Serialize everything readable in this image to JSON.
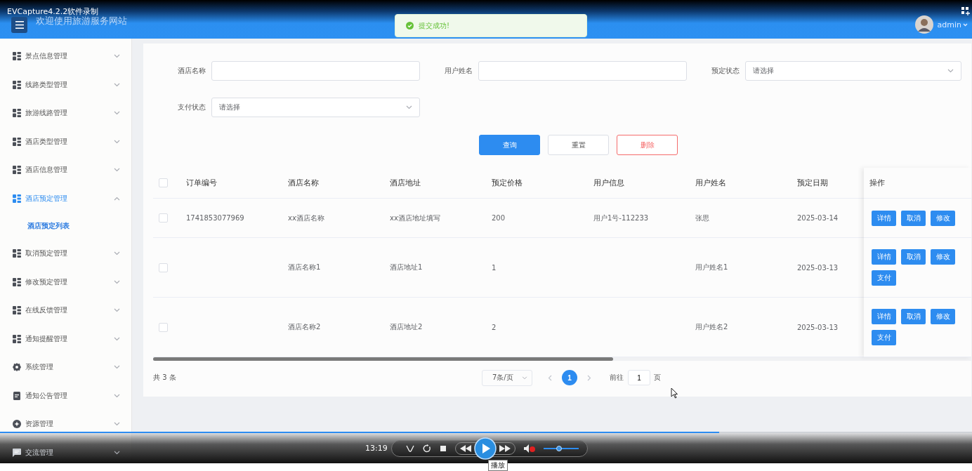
{
  "recorder_label": "EVCapture4.2.2软件录制",
  "header": {
    "title": "欢迎使用旅游服务网站",
    "user": "admin"
  },
  "toast": {
    "message": "提交成功!"
  },
  "sidebar": {
    "items": [
      {
        "label": "景点信息管理",
        "kind": "grid",
        "selected": false,
        "expanded": false
      },
      {
        "label": "线路类型管理",
        "kind": "grid",
        "selected": false,
        "expanded": false
      },
      {
        "label": "旅游线路管理",
        "kind": "grid",
        "selected": false,
        "expanded": false
      },
      {
        "label": "酒店类型管理",
        "kind": "grid",
        "selected": false,
        "expanded": false
      },
      {
        "label": "酒店信息管理",
        "kind": "grid",
        "selected": false,
        "expanded": false
      },
      {
        "label": "酒店预定管理",
        "kind": "grid",
        "selected": true,
        "expanded": true,
        "children": [
          {
            "label": "酒店预定列表",
            "selected": true
          }
        ]
      },
      {
        "label": "取消预定管理",
        "kind": "grid",
        "selected": false,
        "expanded": false
      },
      {
        "label": "修改预定管理",
        "kind": "grid",
        "selected": false,
        "expanded": false
      },
      {
        "label": "在线反馈管理",
        "kind": "grid",
        "selected": false,
        "expanded": false
      },
      {
        "label": "通知提醒管理",
        "kind": "grid",
        "selected": false,
        "expanded": false
      },
      {
        "label": "系统管理",
        "kind": "gear",
        "selected": false,
        "expanded": false
      },
      {
        "label": "通知公告管理",
        "kind": "doc",
        "selected": false,
        "expanded": false
      },
      {
        "label": "资源管理",
        "kind": "plus",
        "selected": false,
        "expanded": false
      },
      {
        "label": "交流管理",
        "kind": "chat",
        "selected": false,
        "expanded": false
      }
    ]
  },
  "filters": [
    {
      "label": "酒店名称",
      "kind": "text"
    },
    {
      "label": "用户姓名",
      "kind": "text"
    },
    {
      "label": "预定状态",
      "kind": "select",
      "placeholder": "请选择"
    },
    {
      "label": "支付状态",
      "kind": "select",
      "placeholder": "请选择"
    }
  ],
  "buttons": [
    {
      "label": "查询",
      "kind": "primary"
    },
    {
      "label": "重置",
      "kind": "default"
    },
    {
      "label": "删除",
      "kind": "danger"
    }
  ],
  "table": {
    "header_checked": false,
    "columns": [
      "订单编号",
      "酒店名称",
      "酒店地址",
      "预定价格",
      "用户信息",
      "用户姓名",
      "预定日期"
    ],
    "actions_label": "操作",
    "rows": [
      {
        "checked": false,
        "cells": [
          "1741853077969",
          "xx酒店名称",
          "xx酒店地址填写",
          "200",
          "用户1号-112233",
          "张思",
          "2025-03-14"
        ],
        "actions": [
          "详情",
          "取消",
          "修改"
        ]
      },
      {
        "checked": false,
        "cells": [
          null,
          "酒店名称1",
          "酒店地址1",
          "1",
          null,
          "用户姓名1",
          "2025-03-13"
        ],
        "actions": [
          "详情",
          "取消",
          "修改",
          "支付"
        ]
      },
      {
        "checked": false,
        "cells": [
          null,
          "酒店名称2",
          "酒店地址2",
          "2",
          null,
          "用户姓名2",
          "2025-03-13"
        ],
        "actions": [
          "详情",
          "取消",
          "修改",
          "支付"
        ]
      }
    ]
  },
  "pagination": {
    "total": "共 3 条",
    "page_size": "7条/页",
    "pages": [
      {
        "label": "1",
        "selected": true
      }
    ],
    "goto_label": "前往",
    "goto_value": "1",
    "suffix": "页"
  },
  "player": {
    "level": 0.74,
    "time": "13:19",
    "muted": true,
    "volume": {
      "level": 0.44
    },
    "tooltip": "播放"
  }
}
